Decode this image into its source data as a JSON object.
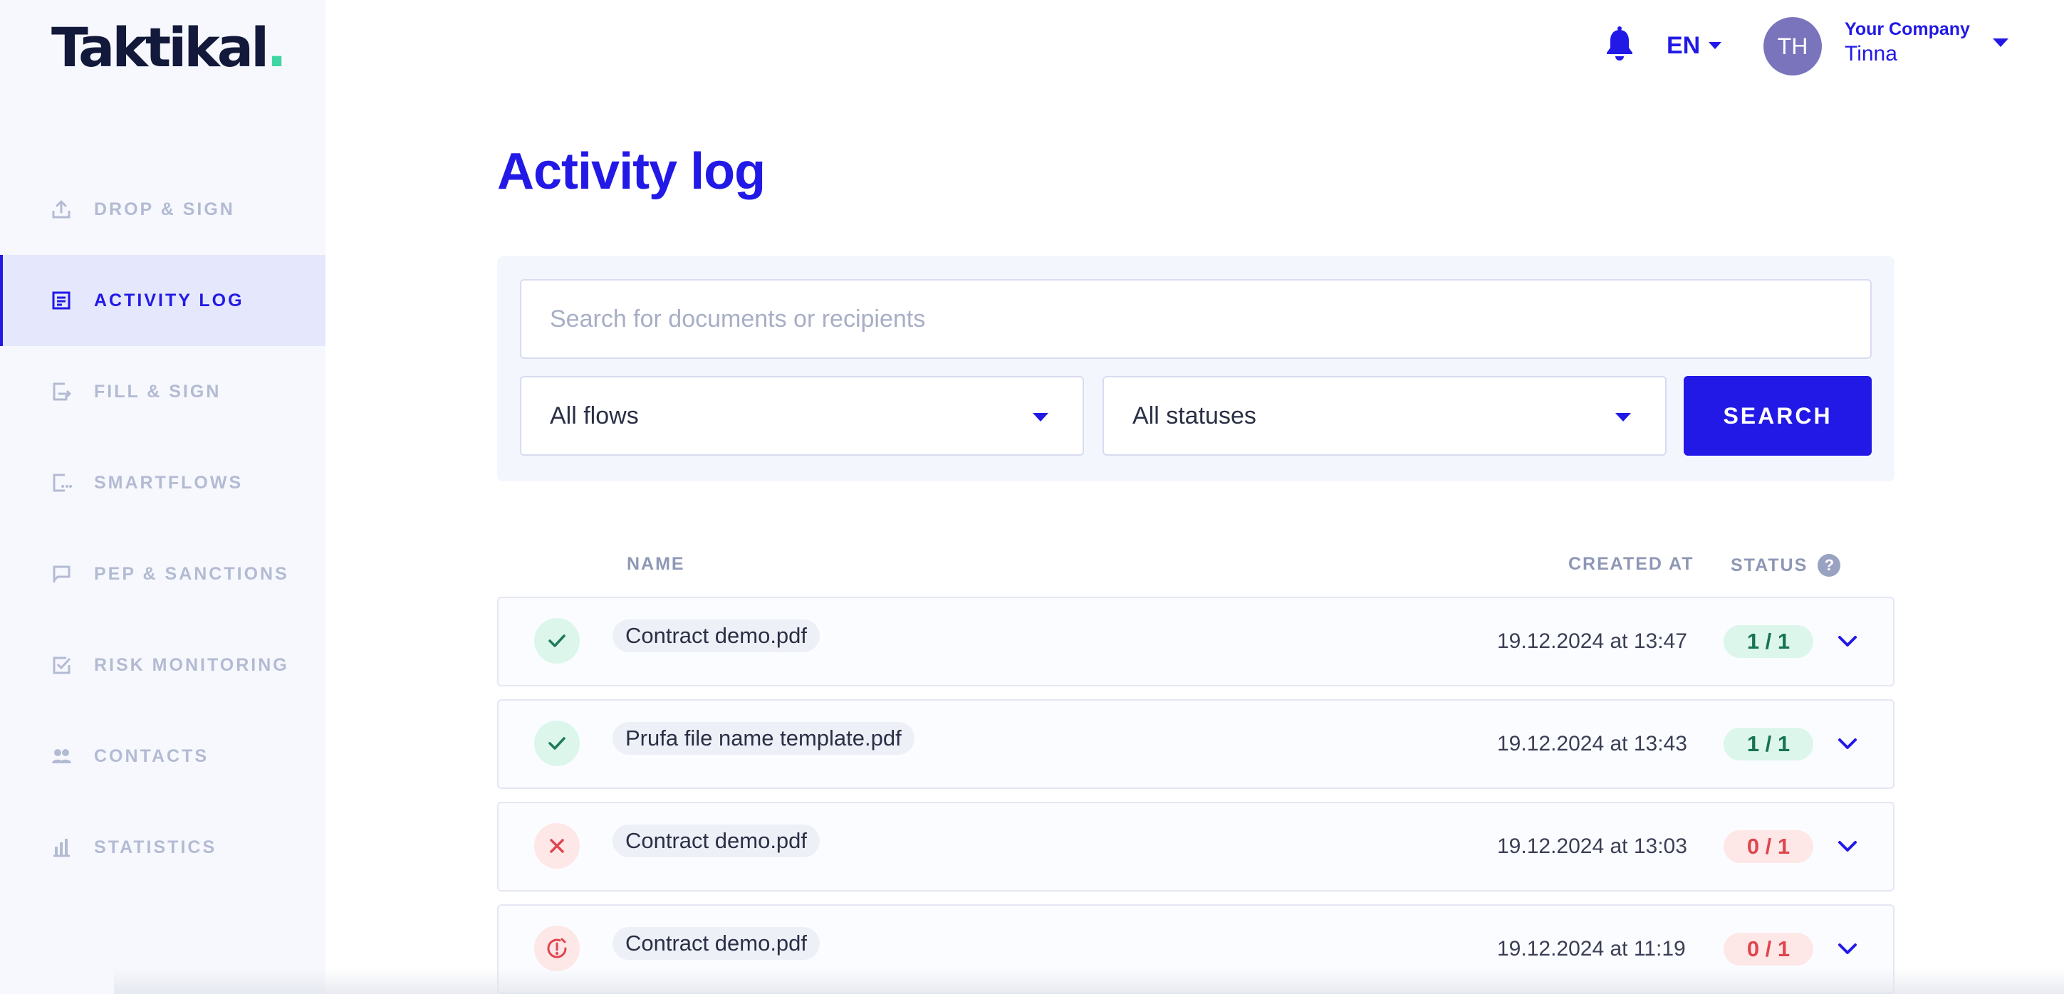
{
  "brand": {
    "name": "Taktikal",
    "dot": ".",
    "accent": "#2219e6",
    "logo_dot_color": "#3fd6a3"
  },
  "header": {
    "bell_icon": "bell-icon",
    "language": "EN",
    "avatar_initials": "TH",
    "company": "Your Company",
    "user": "Tinna"
  },
  "sidebar": {
    "items": [
      {
        "label": "DROP & SIGN",
        "icon": "upload-icon",
        "active": false
      },
      {
        "label": "ACTIVITY LOG",
        "icon": "activity-log-icon",
        "active": true
      },
      {
        "label": "FILL & SIGN",
        "icon": "fill-sign-icon",
        "active": false
      },
      {
        "label": "SMARTFLOWS",
        "icon": "smartflows-icon",
        "active": false
      },
      {
        "label": "PEP & SANCTIONS",
        "icon": "flag-icon",
        "active": false
      },
      {
        "label": "RISK MONITORING",
        "icon": "risk-check-icon",
        "active": false
      },
      {
        "label": "CONTACTS",
        "icon": "contacts-icon",
        "active": false
      },
      {
        "label": "STATISTICS",
        "icon": "bar-chart-icon",
        "active": false
      }
    ]
  },
  "main": {
    "title": "Activity log",
    "search": {
      "placeholder": "Search for documents or recipients",
      "value": ""
    },
    "flows_select": {
      "selected": "All flows"
    },
    "status_select": {
      "selected": "All statuses"
    },
    "search_button": "SEARCH",
    "table": {
      "columns": {
        "name": "NAME",
        "created": "CREATED AT",
        "status": "STATUS",
        "help": "?"
      },
      "rows": [
        {
          "state": "completed",
          "icon": "check-icon",
          "name": "Contract demo.pdf",
          "created": "19.12.2024 at 13:47",
          "status": "1 / 1"
        },
        {
          "state": "completed",
          "icon": "check-icon",
          "name": "Prufa file name template.pdf",
          "created": "19.12.2024 at 13:43",
          "status": "1 / 1"
        },
        {
          "state": "rejected",
          "icon": "close-x-icon",
          "name": "Contract demo.pdf",
          "created": "19.12.2024 at 13:03",
          "status": "0 / 1"
        },
        {
          "state": "expired",
          "icon": "clock-alert-icon",
          "name": "Contract demo.pdf",
          "created": "19.12.2024 at 11:19",
          "status": "0 / 1"
        }
      ]
    }
  }
}
